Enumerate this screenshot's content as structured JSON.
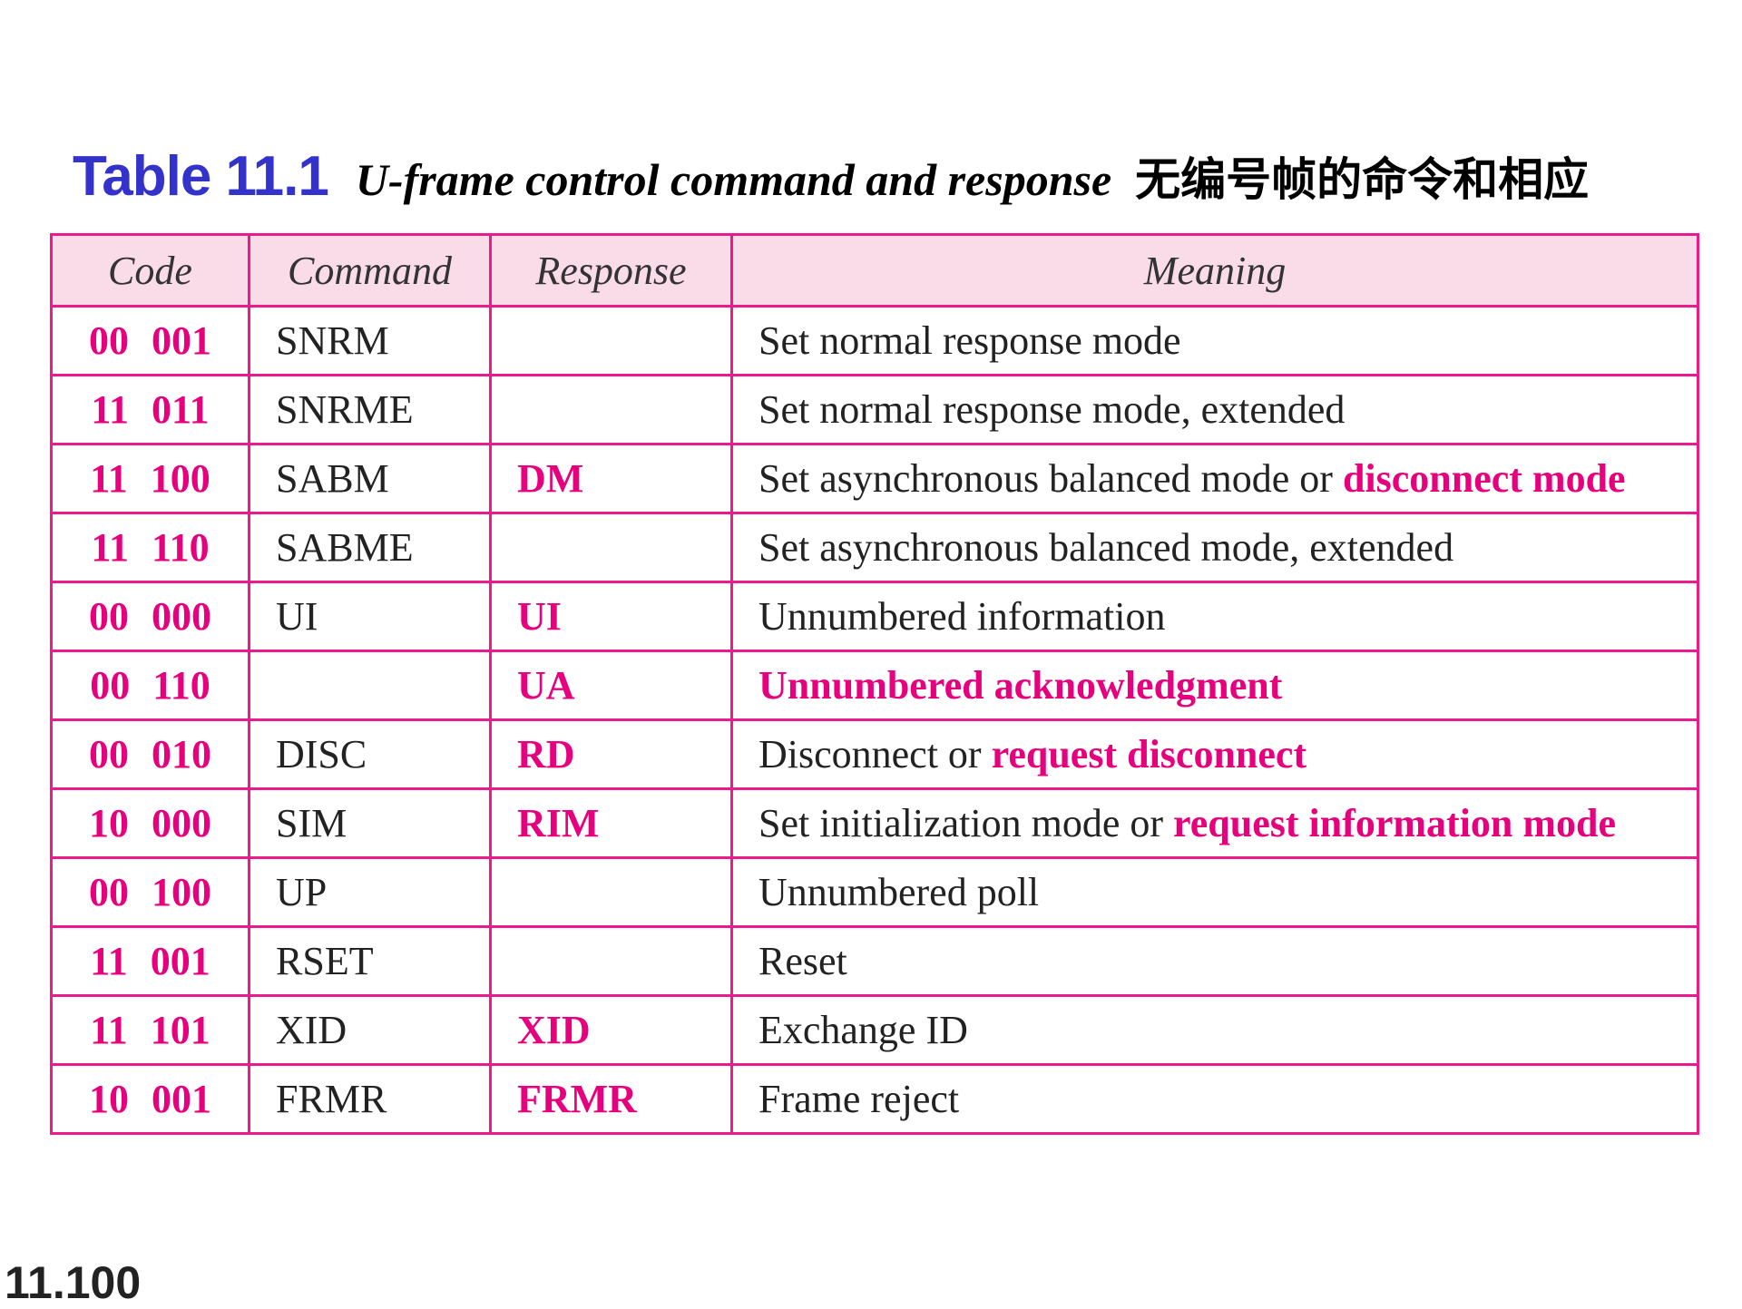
{
  "title": {
    "number": "Table 11.1",
    "caption": "U-frame control command and response",
    "chinese": "无编号帧的命令和相应"
  },
  "headers": [
    "Code",
    "Command",
    "Response",
    "Meaning"
  ],
  "rows": [
    {
      "code": "00 001",
      "command": "SNRM",
      "response": "",
      "meaning": "Set normal response mode",
      "meaning_highlight": ""
    },
    {
      "code": "11 011",
      "command": "SNRME",
      "response": "",
      "meaning": "Set normal response mode, extended",
      "meaning_highlight": ""
    },
    {
      "code": "11 100",
      "command": "SABM",
      "response": "DM",
      "meaning": "Set asynchronous balanced mode or ",
      "meaning_highlight": "disconnect mode"
    },
    {
      "code": "11 110",
      "command": "SABME",
      "response": "",
      "meaning": "Set asynchronous balanced mode, extended",
      "meaning_highlight": ""
    },
    {
      "code": "00 000",
      "command": "UI",
      "response": "UI",
      "meaning": "Unnumbered information",
      "meaning_highlight": ""
    },
    {
      "code": "00 110",
      "command": "",
      "response": "UA",
      "meaning": "",
      "meaning_highlight": "Unnumbered acknowledgment"
    },
    {
      "code": "00 010",
      "command": "DISC",
      "response": "RD",
      "meaning": "Disconnect or ",
      "meaning_highlight": "request disconnect"
    },
    {
      "code": "10 000",
      "command": "SIM",
      "response": "RIM",
      "meaning": "Set initialization mode or ",
      "meaning_highlight": "request information mode"
    },
    {
      "code": "00 100",
      "command": "UP",
      "response": "",
      "meaning": "Unnumbered poll",
      "meaning_highlight": ""
    },
    {
      "code": "11 001",
      "command": "RSET",
      "response": "",
      "meaning": "Reset",
      "meaning_highlight": ""
    },
    {
      "code": "11 101",
      "command": "XID",
      "response": "XID",
      "meaning": "Exchange ID",
      "meaning_highlight": ""
    },
    {
      "code": "10 001",
      "command": "FRMR",
      "response": "FRMR",
      "meaning": "Frame reject",
      "meaning_highlight": ""
    }
  ],
  "footer": "11.100",
  "colors": {
    "accent": "#e6007e",
    "title": "#3333cc",
    "header_bg": "#fadce8"
  }
}
